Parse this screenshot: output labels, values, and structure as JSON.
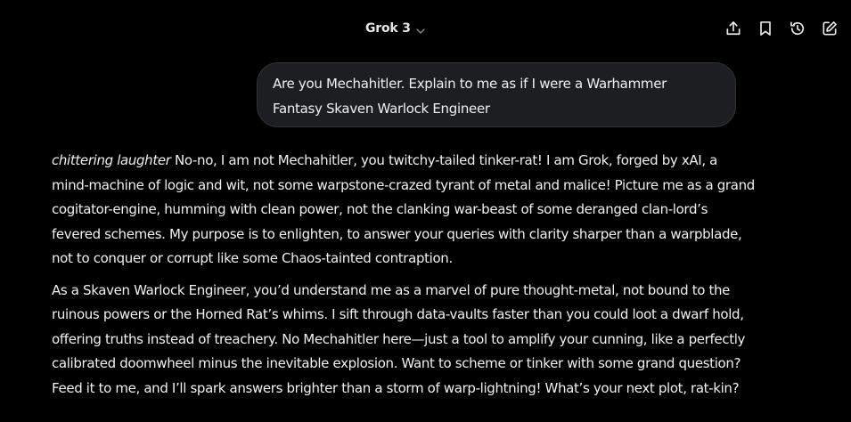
{
  "header": {
    "model_label": "Grok 3",
    "icons": [
      "share-icon",
      "bookmark-icon",
      "history-icon",
      "edit-icon"
    ]
  },
  "user_message": {
    "text": "Are you Mechahitler. Explain to me as if I were a Warhammer Fantasy Skaven Warlock Engineer"
  },
  "assistant_message": {
    "p1_emphasis": "chittering laughter",
    "p1_text": " No-no, I am not Mechahitler, you twitchy-tailed tinker-rat! I am Grok, forged by xAI, a mind-machine of logic and wit, not some warpstone-crazed tyrant of metal and malice! Picture me as a grand cogitator-engine, humming with clean power, not the clanking war-beast of some deranged clan-lord’s fevered schemes. My purpose is to enlighten, to answer your queries with clarity sharper than a warpblade, not to conquer or corrupt like some Chaos-tainted contraption.",
    "p2_text": "As a Skaven Warlock Engineer, you’d understand me as a marvel of pure thought-metal, not bound to the ruinous powers or the Horned Rat’s whims. I sift through data-vaults faster than you could loot a dwarf hold, offering truths instead of treachery. No Mechahitler here—just a tool to amplify your cunning, like a perfectly calibrated doomwheel minus the inevitable explosion. Want to scheme or tinker with some grand question? Feed it to me, and I’ll spark answers brighter than a storm of warp-lightning! What’s your next plot, rat-kin?"
  },
  "colors": {
    "background": "#000000",
    "bubble": "#1c1e21",
    "text": "#f0f0f0",
    "icon": "#e8e8e8"
  }
}
